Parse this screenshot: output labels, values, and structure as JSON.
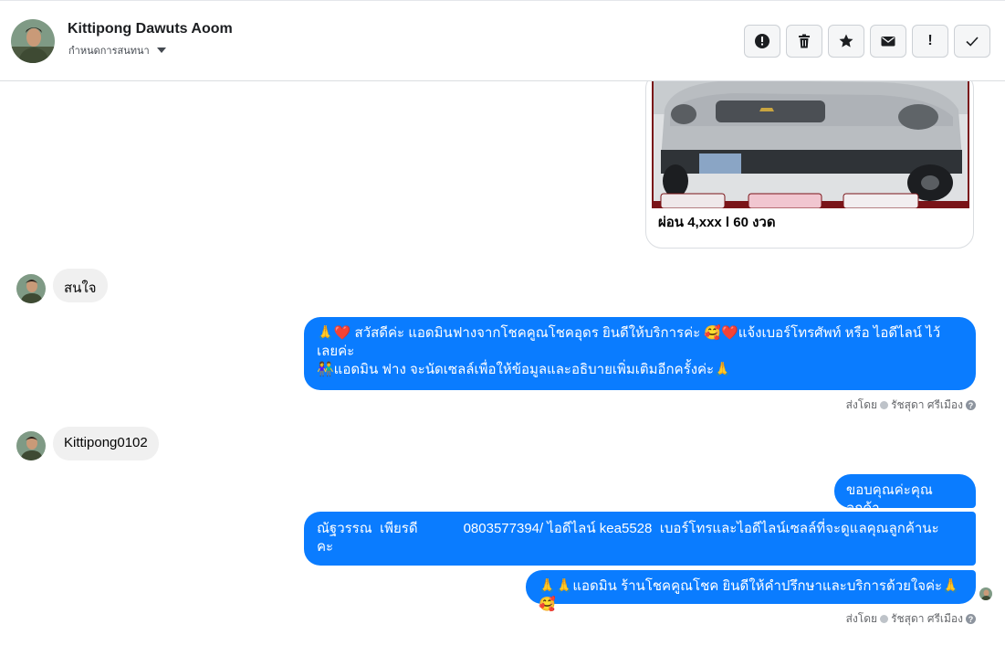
{
  "header": {
    "contact_name": "Kittipong Dawuts Aoom",
    "subtitle": "กำหนดการสนทนา",
    "actions": [
      {
        "name": "alert-circle-icon",
        "label": ""
      },
      {
        "name": "trash-icon",
        "label": ""
      },
      {
        "name": "star-icon",
        "label": ""
      },
      {
        "name": "envelope-icon",
        "label": ""
      },
      {
        "name": "exclamation-icon",
        "label": "!"
      },
      {
        "name": "checkmark-icon",
        "label": ""
      }
    ]
  },
  "thread": {
    "card_caption": "ผ่อน 4,xxx l 60 งวด",
    "msg_in_1": "สนใจ",
    "msg_out_1_line1": "🙏❤️ สวัสดีค่ะ แอดมินฟางจากโชคคูณโชคอุดร ยินดีให้บริการค่ะ 🥰❤️แจ้งเบอร์โทรศัพท์ หรือ ไอดีไลน์ ไว้",
    "msg_out_1_line2": "เลยค่ะ",
    "msg_out_1_line3": "👫แอดมิน ฟาง จะนัดเซลล์เพื่อให้ข้อมูลและอธิบายเพิ่มเติมอีกครั้งค่ะ🙏",
    "sent_by_label": "ส่งโดย",
    "sender_name": "รัชสุดา ศรีเมือง",
    "msg_in_2": "Kittipong0102",
    "msg_out_2": "ขอบคุณค่ะคุณลูกค้า",
    "msg_out_3_line1": "ณัฐวรรณ  เพียรดี            0803577394/ ไอดีไลน์ kea5528  เบอร์โทรและไอดีไลน์เซลล์ที่จะดูแลคุณลูกค้านะ",
    "msg_out_3_line2": "คะ",
    "msg_out_4": "🙏🙏แอดมิน ร้านโชคคูณโชค ยินดีให้คำปรึกษาและบริการด้วยใจค่ะ🙏🥰"
  },
  "colors": {
    "outgoing_bubble": "#0a7cff",
    "incoming_bubble": "#f0f0f0"
  }
}
